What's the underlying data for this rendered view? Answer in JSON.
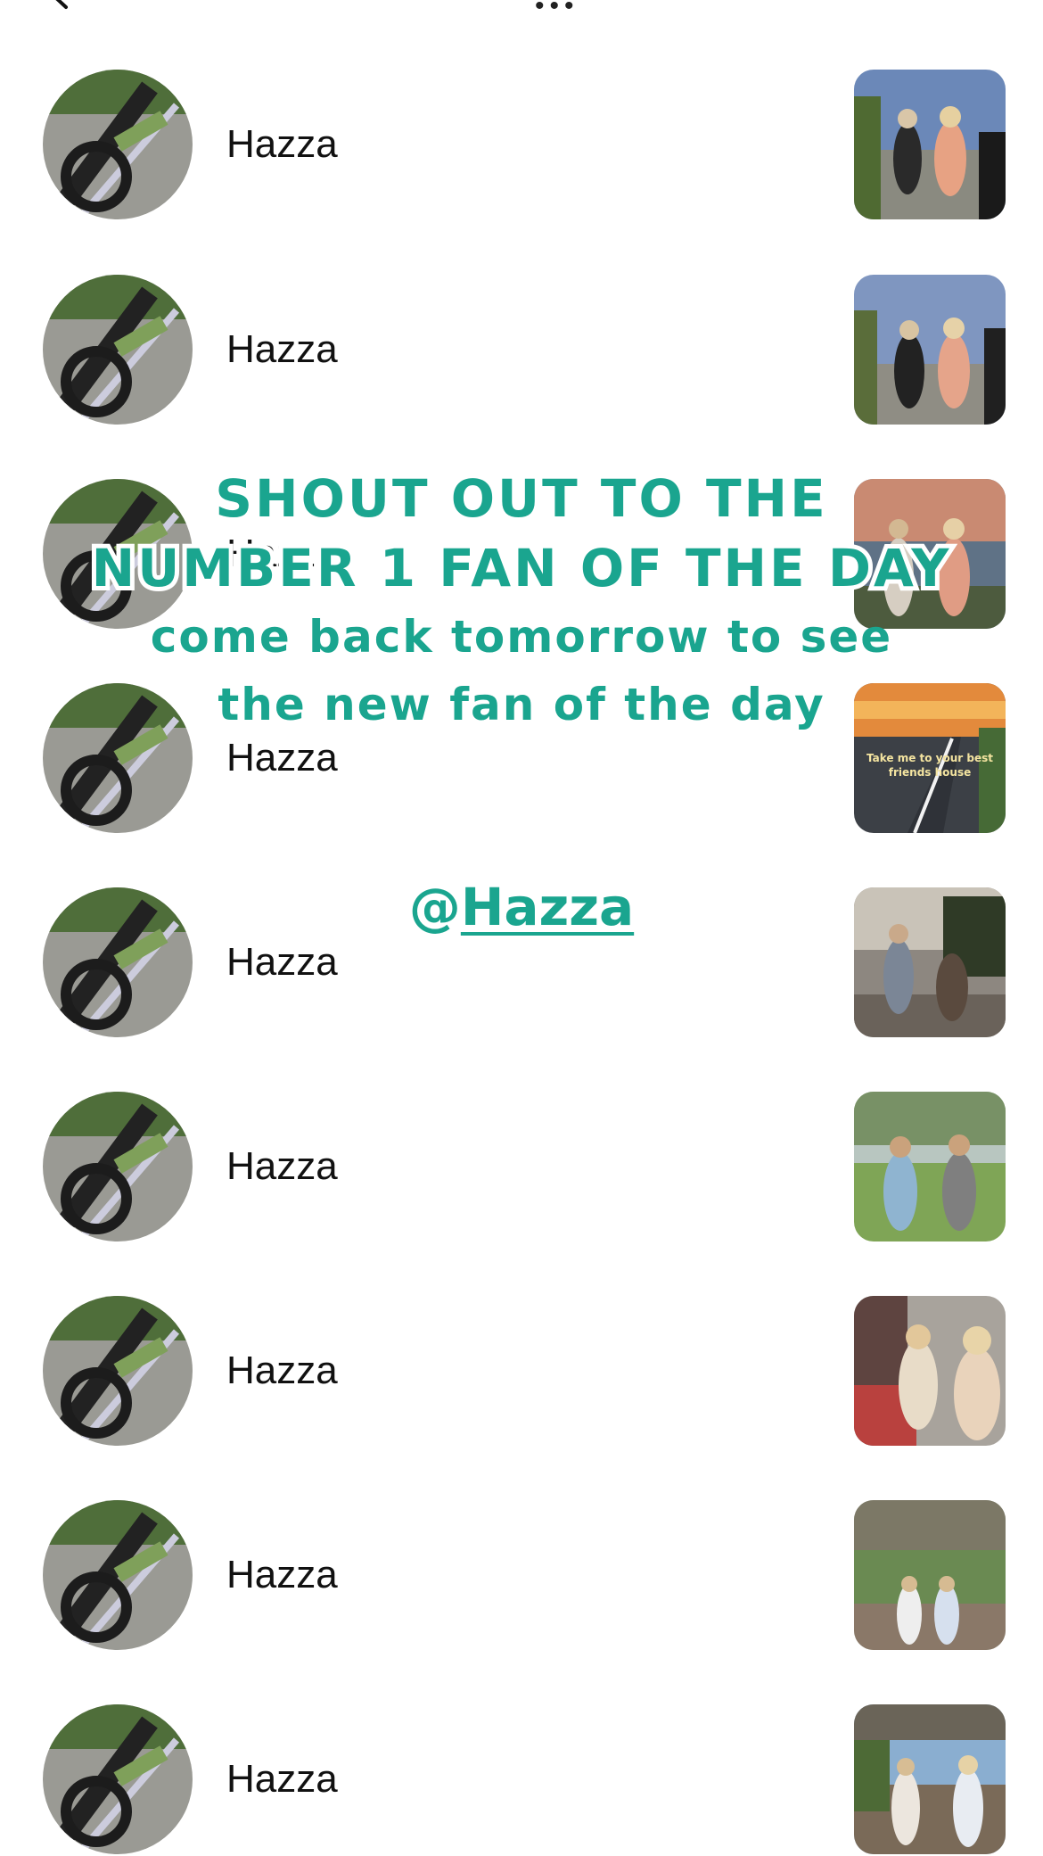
{
  "top_bar": {
    "back_icon": "chevron-left-icon",
    "more_icon": "more-dots-icon"
  },
  "rows": [
    {
      "name": "Hazza",
      "thumbnail": "video-thumbnail"
    },
    {
      "name": "Hazza",
      "thumbnail": "video-thumbnail"
    },
    {
      "name": "Hazza",
      "thumbnail": "video-thumbnail"
    },
    {
      "name": "Hazza",
      "thumbnail": "video-thumbnail",
      "thumbnail_caption": "Take me to your best friends house"
    },
    {
      "name": "Hazza",
      "thumbnail": "video-thumbnail"
    },
    {
      "name": "Hazza",
      "thumbnail": "video-thumbnail"
    },
    {
      "name": "Hazza",
      "thumbnail": "video-thumbnail"
    },
    {
      "name": "Hazza",
      "thumbnail": "video-thumbnail"
    },
    {
      "name": "Hazza",
      "thumbnail": "video-thumbnail"
    }
  ],
  "overlay": {
    "line1": "SHOUT OUT TO THE",
    "line2": "NUMBER 1 FAN OF THE DAY",
    "line3": "come back tomorrow to see",
    "line4": "the new fan of the day",
    "handle_prefix": "@",
    "handle_name": "Hazza",
    "color": "#1aa58f"
  }
}
